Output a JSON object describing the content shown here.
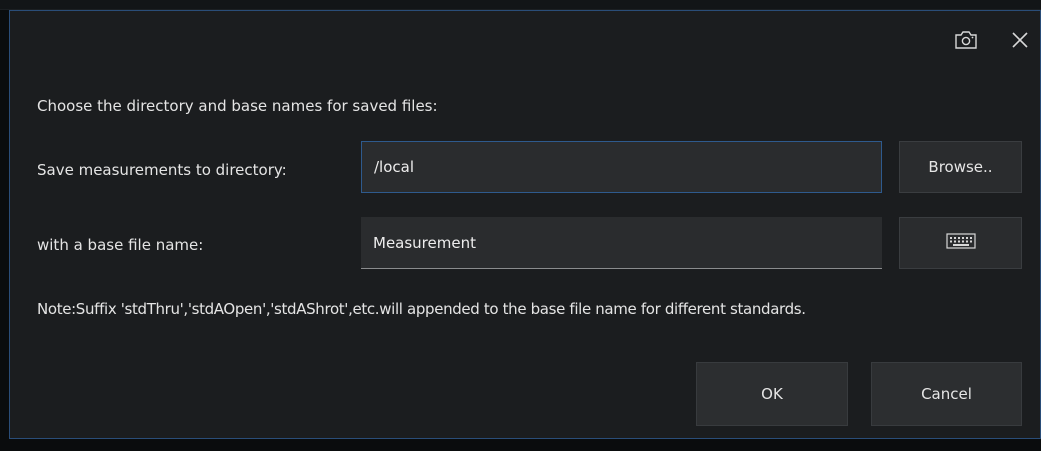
{
  "dialog": {
    "prompt": "Choose the directory and base names for saved files:",
    "directory": {
      "label": "Save measurements to directory:",
      "value": "/local",
      "browse_label": "Browse.."
    },
    "base_name": {
      "label": "with a base file name:",
      "value": "Measurement"
    },
    "note": "Note:Suffix 'stdThru','stdAOpen','stdAShrot',etc.will appended to the base file name for different standards.",
    "ok_label": "OK",
    "cancel_label": "Cancel"
  },
  "icons": {
    "screenshot": "camera-icon",
    "close": "close-icon",
    "keyboard": "keyboard-icon"
  },
  "colors": {
    "dialog_bg": "#1b1d1f",
    "field_bg": "#2a2c2e",
    "focus_border": "#2e5a8d",
    "text": "#e4e4e4"
  }
}
